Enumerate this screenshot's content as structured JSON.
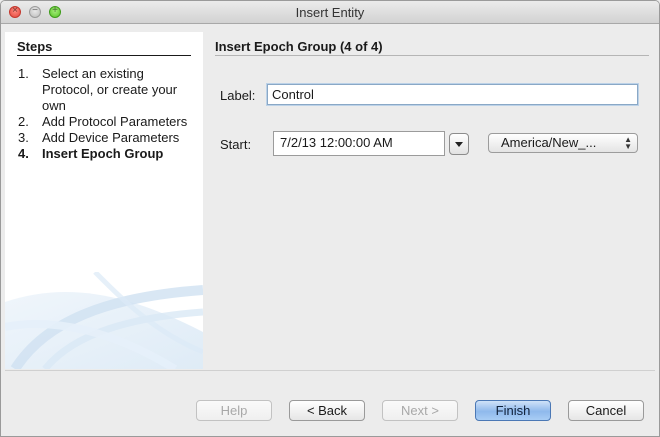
{
  "window": {
    "title": "Insert Entity"
  },
  "steps": {
    "heading": "Steps",
    "items": [
      {
        "num": "1.",
        "label": "Select an existing Protocol, or create your own",
        "active": false
      },
      {
        "num": "2.",
        "label": "Add Protocol Parameters",
        "active": false
      },
      {
        "num": "3.",
        "label": "Add Device Parameters",
        "active": false
      },
      {
        "num": "4.",
        "label": "Insert Epoch Group",
        "active": true
      }
    ]
  },
  "form": {
    "heading": "Insert Epoch Group (4 of 4)",
    "label_caption": "Label:",
    "label_value": "Control",
    "start_caption": "Start:",
    "start_value": "7/2/13 12:00:00 AM",
    "timezone_value": "America/New_..."
  },
  "buttons": {
    "help": "Help",
    "back": "< Back",
    "next": "Next >",
    "finish": "Finish",
    "cancel": "Cancel"
  },
  "colors": {
    "accent": "#8fb9ec",
    "window_bg": "#ececec",
    "panel_bg": "#ffffff"
  }
}
